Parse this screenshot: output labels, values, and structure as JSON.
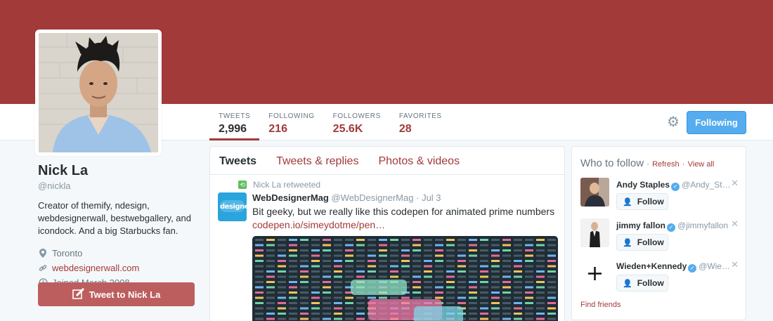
{
  "colors": {
    "brand": "#a23a3a",
    "button_blue": "#55acee",
    "tweet_to": "#bd5e5e"
  },
  "nav": {
    "stats": [
      {
        "label": "TWEETS",
        "value": "2,996"
      },
      {
        "label": "FOLLOWING",
        "value": "216"
      },
      {
        "label": "FOLLOWERS",
        "value": "25.6K"
      },
      {
        "label": "FAVORITES",
        "value": "28"
      }
    ],
    "settings_icon": "gear-icon",
    "following_label": "Following"
  },
  "profile": {
    "name": "Nick La",
    "handle": "@nickla",
    "bio": "Creator of themify, ndesign, webdesignerwall, bestwebgallery, and icondock. And a big Starbucks fan.",
    "location": "Toronto",
    "website": "webdesignerwall.com",
    "joined": "Joined March 2008",
    "tweet_to_label": "Tweet to Nick La"
  },
  "timeline": {
    "tabs": [
      "Tweets",
      "Tweets & replies",
      "Photos & videos"
    ],
    "retweeted_by": "Nick La retweeted",
    "tweet": {
      "author": "WebDesignerMag",
      "handle": "@WebDesignerMag",
      "date": "Jul 3",
      "avatar_text": "designer",
      "text": "Bit geeky, but we really like this codepen for animated prime numbers",
      "link": "codepen.io/simeydotme/pen…"
    }
  },
  "who_to_follow": {
    "title": "Who to follow",
    "refresh": "Refresh",
    "view_all": "View all",
    "follow_label": "Follow",
    "items": [
      {
        "name": "Andy Staples",
        "handle": "@Andy_St…"
      },
      {
        "name": "jimmy fallon",
        "handle": "@jimmyfallon"
      },
      {
        "name": "Wieden+Kennedy",
        "handle": "@Wie…"
      }
    ],
    "find_friends": "Find friends"
  }
}
